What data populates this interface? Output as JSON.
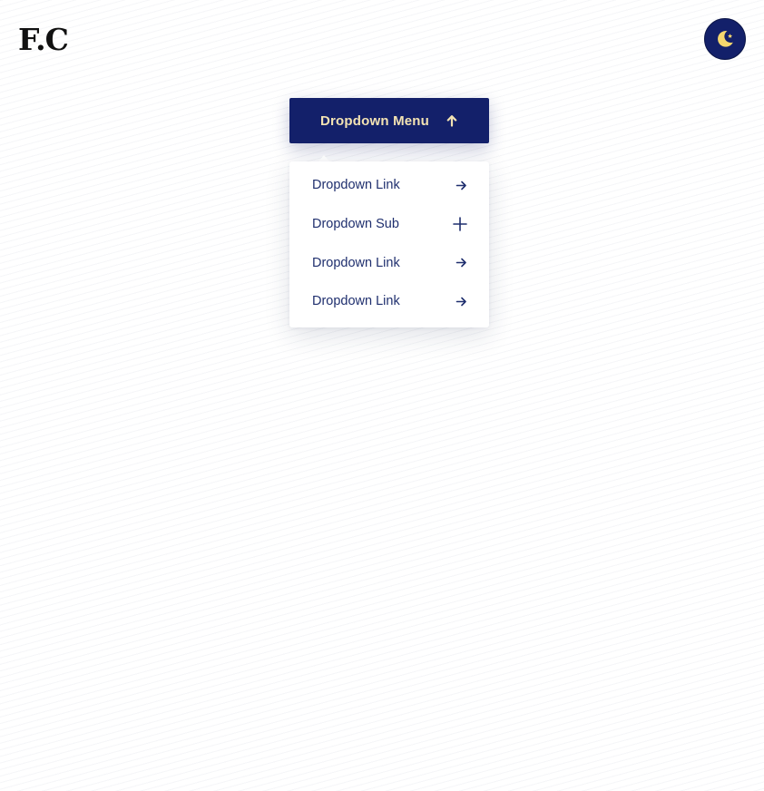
{
  "header": {
    "logo_text": "F.C",
    "theme_toggle_icon": "moon-star-icon"
  },
  "dropdown": {
    "button_label": "Dropdown Menu",
    "button_icon": "arrow-up-icon",
    "items": [
      {
        "label": "Dropdown Link",
        "icon": "arrow-right-icon"
      },
      {
        "label": "Dropdown Sub",
        "icon": "plus-icon"
      },
      {
        "label": "Dropdown Link",
        "icon": "arrow-right-icon"
      },
      {
        "label": "Dropdown Link",
        "icon": "arrow-right-icon"
      }
    ]
  },
  "colors": {
    "primary": "#13206a",
    "button_text": "#f3e3b3",
    "moon": "#f5d76e",
    "menu_text": "#1f2f6e"
  }
}
